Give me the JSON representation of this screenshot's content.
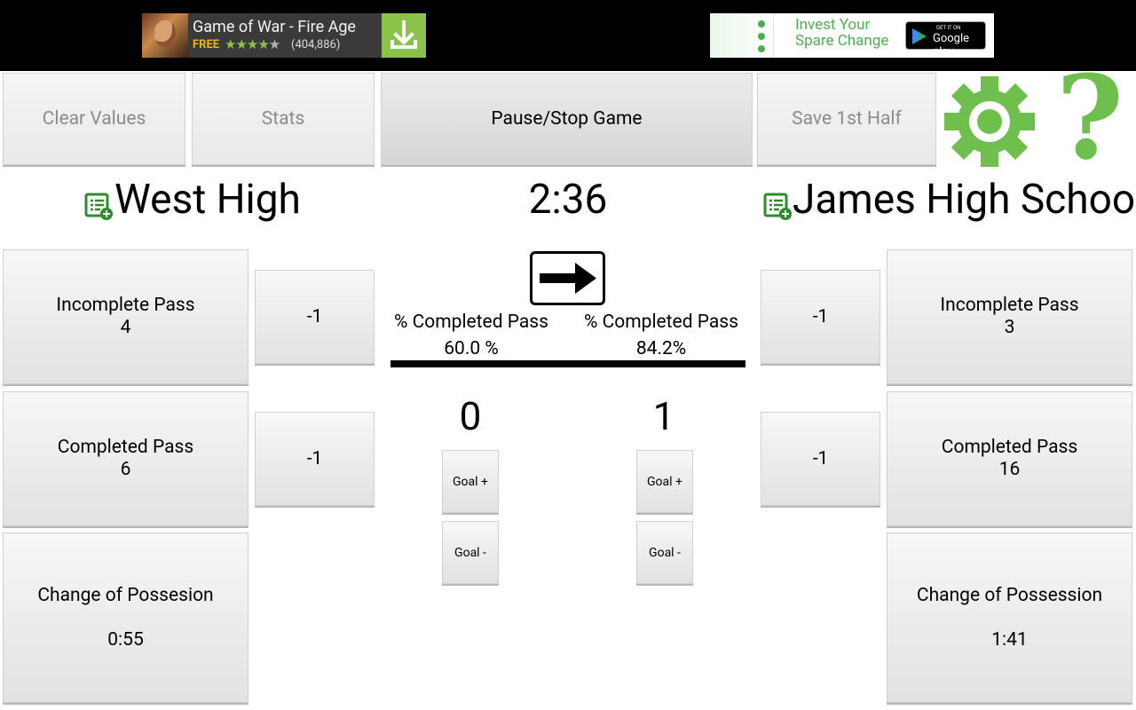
{
  "ads": {
    "left": {
      "title": "Game of War - Fire Age",
      "free": "FREE",
      "stars": "★★★★★",
      "rating_count": "(404,886)",
      "rating_stars": 4.5,
      "icon": "download-icon",
      "accent": "#8bc34a"
    },
    "right": {
      "line1": "Invest Your",
      "line2": "Spare Change",
      "badge_small": "GET IT ON",
      "badge_big": "Google play",
      "accent": "#4caf50"
    }
  },
  "toolbar": {
    "clear": "Clear Values",
    "stats": "Stats",
    "pause": "Pause/Stop Game",
    "save": "Save 1st Half",
    "settings_icon": "gear-icon",
    "help_icon": "question-icon",
    "help_glyph": "?",
    "icon_color": "#6fbf4f"
  },
  "clock": "2:36",
  "direction_icon": "arrow-right-icon",
  "home": {
    "name": "West High",
    "incomplete_label": "Incomplete Pass",
    "incomplete": "4",
    "completed_label": "Completed Pass",
    "completed": "6",
    "possession_label": "Change of Possesion",
    "possession_time": "0:55",
    "minus": "-1",
    "pct_label": "% Completed Pass",
    "pct": "60.0 %",
    "score": "0",
    "goal_plus": "Goal +",
    "goal_minus": "Goal -"
  },
  "away": {
    "name": "James High School",
    "incomplete_label": "Incomplete Pass",
    "incomplete": "3",
    "completed_label": "Completed Pass",
    "completed": "16",
    "possession_label": "Change of Possession",
    "possession_time": "1:41",
    "minus": "-1",
    "pct_label": "% Completed Pass",
    "pct": "84.2%",
    "score": "1",
    "goal_plus": "Goal +",
    "goal_minus": "Goal -"
  }
}
